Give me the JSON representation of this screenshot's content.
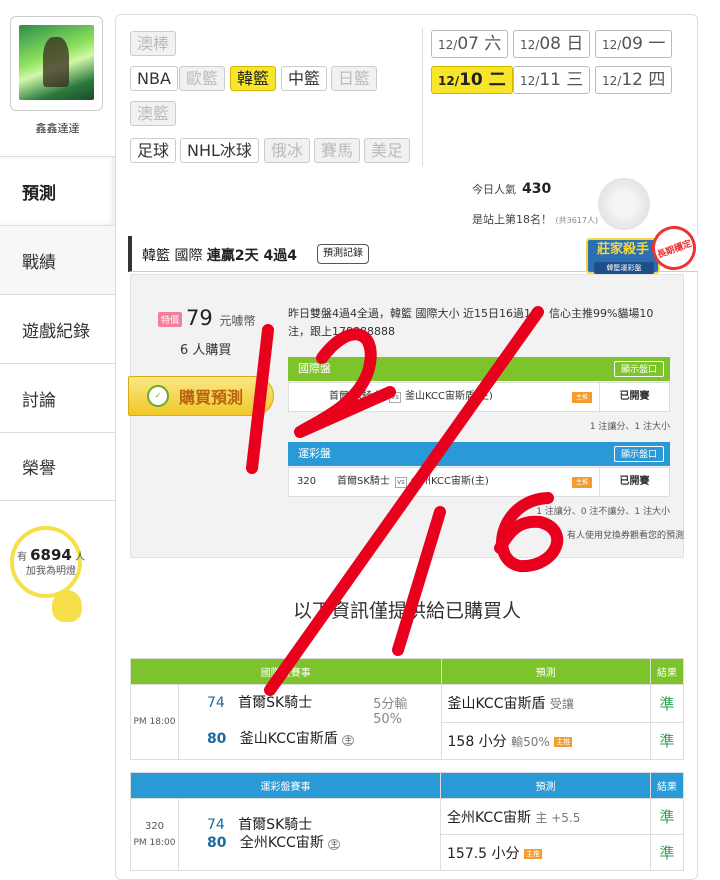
{
  "user": {
    "name": "鑫鑫達達"
  },
  "nav": [
    {
      "label": "預測"
    },
    {
      "label": "戰績"
    },
    {
      "label": "遊戲紀錄"
    },
    {
      "label": "討論"
    },
    {
      "label": "榮譽"
    }
  ],
  "fans": {
    "prefix": "有",
    "count": "6894",
    "unit": "人",
    "caption": "加我為明燈"
  },
  "sports": [
    {
      "label": "澳棒",
      "state": "disabled"
    },
    {
      "label": "NBA",
      "state": "normal"
    },
    {
      "label": "歐籃",
      "state": "disabled"
    },
    {
      "label": "韓籃",
      "state": "selected"
    },
    {
      "label": "中籃",
      "state": "normal"
    },
    {
      "label": "日籃",
      "state": "disabled"
    },
    {
      "label": "澳籃",
      "state": "disabled"
    },
    {
      "label": "足球",
      "state": "normal"
    },
    {
      "label": "NHL冰球",
      "state": "normal"
    },
    {
      "label": "俄冰",
      "state": "disabled"
    },
    {
      "label": "賽馬",
      "state": "disabled"
    },
    {
      "label": "美足",
      "state": "disabled"
    }
  ],
  "dates": [
    {
      "md": "12/",
      "d": "07",
      "w": "六",
      "state": "normal"
    },
    {
      "md": "12/",
      "d": "08",
      "w": "日",
      "state": "normal"
    },
    {
      "md": "12/",
      "d": "09",
      "w": "一",
      "state": "normal"
    },
    {
      "md": "12/",
      "d": "10",
      "w": "二",
      "state": "selected"
    },
    {
      "md": "12/",
      "d": "11",
      "w": "三",
      "state": "normal"
    },
    {
      "md": "12/",
      "d": "12",
      "w": "四",
      "state": "normal"
    }
  ],
  "stats": {
    "pop_label": "今日人氣",
    "pop_value": "430",
    "rank_text": "是站上第18名！",
    "rank_total": "(共3617人)"
  },
  "streak": {
    "league": "韓籃 國際",
    "record": "連贏2天 4過4",
    "history_btn": "預測記錄"
  },
  "badge": {
    "title": "莊家殺手",
    "sub": "韓籃運彩盤",
    "stamp": "長期穩定"
  },
  "offer": {
    "price_label": "特價",
    "price": "79",
    "price_unit": "元噱幣",
    "buyers": "6 人購買",
    "buy_btn": "購買預測"
  },
  "description": "昨日雙盤4過4全過，韓籃 國際大小 近15日16過13，信心主推99%貓場10注，跟上178888888",
  "intl_market": {
    "title": "國際盤",
    "show_btn": "顯示盤口",
    "away": "首爾SK騎士",
    "vs": "vs",
    "home": "釜山KCC宙斯盾(主)",
    "chip": "主推",
    "status": "已開賽",
    "note": "1 注讓分、1 注大小"
  },
  "lottery_market": {
    "title": "運彩盤",
    "show_btn": "顯示盤口",
    "num": "320",
    "away": "首爾SK騎士",
    "vs": "vs",
    "home": "全州KCC宙斯(主)",
    "chip": "主推",
    "status": "已開賽",
    "note": "1 注讓分、0 注不讓分、1 注大小",
    "note2": "有人使用兌換券觀看您的預測"
  },
  "info_line": "以下資訊僅提供給已購買人",
  "table1": {
    "h_event": "國際盤賽事",
    "h_pred": "預測",
    "h_result": "結果",
    "time": "PM 18:00",
    "away_num": "74",
    "away": "首爾SK騎士",
    "home_num": "80",
    "home": "釜山KCC宙斯盾",
    "home_tag": "主",
    "line": "5分輸",
    "line2": "50%",
    "p1": "釜山KCC宙斯盾",
    "p1_sub": "受讓",
    "r1": "準",
    "p2": "158 小分",
    "p2_sub": "輸50%",
    "p2_chip": "主推",
    "r2": "準"
  },
  "table2": {
    "h_event": "運彩盤賽事",
    "h_pred": "預測",
    "h_result": "結果",
    "num": "320",
    "time": "PM 18:00",
    "away_num": "74",
    "away": "首爾SK騎士",
    "home_num": "80",
    "home": "全州KCC宙斯",
    "home_tag": "主",
    "p1": "全州KCC宙斯",
    "p1_sub": "主 +5.5",
    "r1": "準",
    "p2": "157.5 小分",
    "p2_chip": "主推",
    "r2": "準"
  },
  "handwriting": "12/16",
  "colors": {
    "accent_yellow": "#f7e52a",
    "green_header": "#7cc32c",
    "blue_header": "#2a9ad6",
    "ink_red": "#e8001c",
    "win_green": "#2ea24b"
  }
}
